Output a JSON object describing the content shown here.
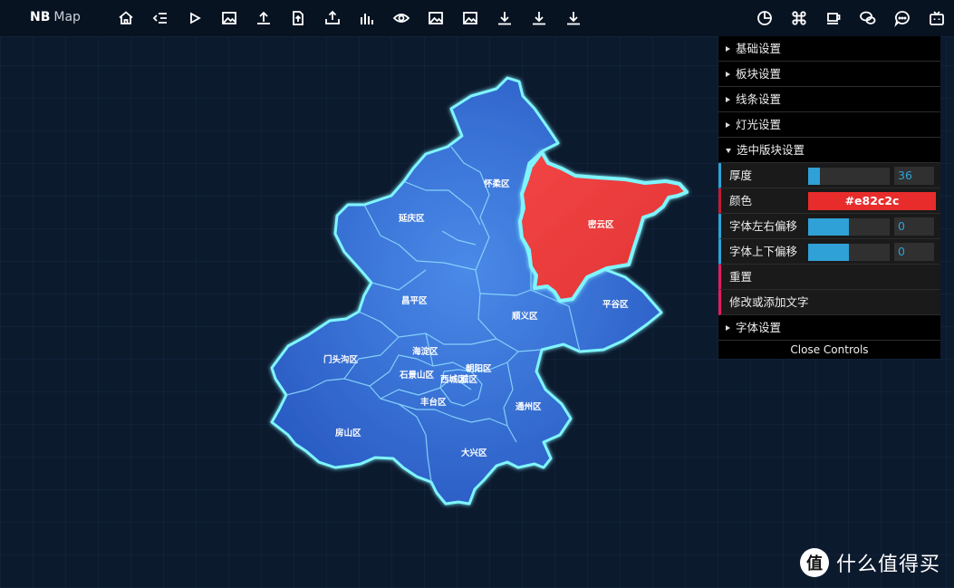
{
  "app": {
    "logo_bold": "NB",
    "logo_light": "Map"
  },
  "toolbar_left": [
    "home-icon",
    "list-icon",
    "play-icon",
    "image-icon",
    "upload-icon",
    "file-upload-icon",
    "export-icon",
    "bar-chart-icon",
    "eye-icon",
    "image-icon",
    "image-icon",
    "download-icon",
    "download-icon",
    "download-icon"
  ],
  "toolbar_right": [
    "pie-chart-icon",
    "command-icon",
    "cup-icon",
    "wechat-icon",
    "chat-icon",
    "tv-icon"
  ],
  "districts": {
    "huairou": "怀柔区",
    "yanqing": "延庆区",
    "miyun": "密云区",
    "changping": "昌平区",
    "shunyi": "顺义区",
    "pinggu": "平谷区",
    "haidian": "海淀区",
    "mentougou": "门头沟区",
    "shijingshan": "石景山区",
    "chaoyang": "朝阳区",
    "xicheng": "西城区",
    "dongcheng": "城区",
    "fengtai": "丰台区",
    "tongzhou": "通州区",
    "fangshan": "房山区",
    "daxing": "大兴区"
  },
  "panel": {
    "folders": {
      "basic": "基础设置",
      "block": "板块设置",
      "line": "线条设置",
      "light": "灯光设置",
      "selected": "选中版块设置",
      "font": "字体设置"
    },
    "thickness": {
      "label": "厚度",
      "value": "36",
      "fraction": 0.14
    },
    "color": {
      "label": "颜色",
      "value": "#e82c2c"
    },
    "offset_x": {
      "label": "字体左右偏移",
      "value": "0",
      "fraction": 0.5
    },
    "offset_y": {
      "label": "字体上下偏移",
      "value": "0",
      "fraction": 0.5
    },
    "reset": "重置",
    "edit_text": "修改或添加文字",
    "close": "Close Controls"
  },
  "watermark": {
    "symbol": "值",
    "text": "什么值得买"
  },
  "colors": {
    "map_fill": "#3d7fe0",
    "selected_fill": "#e83a3a",
    "glow": "#7ff5ff",
    "panel_accent": "#2fa1d6"
  }
}
